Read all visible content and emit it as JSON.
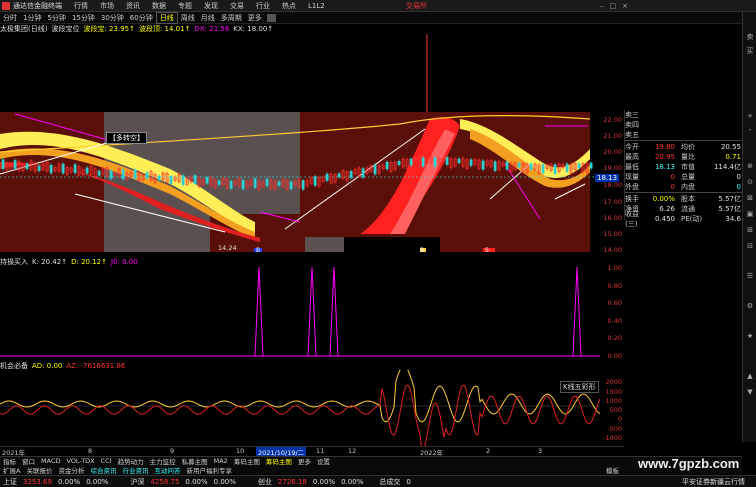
{
  "menubar": {
    "app_name": "通达信金融终端",
    "items": [
      "行情",
      "市场",
      "资讯",
      "数据",
      "专题",
      "发现",
      "交易",
      "行业",
      "热点",
      "L1L2"
    ],
    "trade_label": "交易所"
  },
  "toolbar": {
    "periods": [
      "分时",
      "1分钟",
      "5分钟",
      "15分钟",
      "30分钟",
      "60分钟",
      "日线",
      "周线",
      "月线",
      "多周期",
      "更多"
    ],
    "active_period": "日线"
  },
  "main_panel": {
    "title": "太极集团(日线)",
    "indicator_name": "波段宝位",
    "l1": "波段宝: 23.95↑",
    "l2": "波段顶: 14.01↑",
    "l3": "DX: 21.56",
    "l4": "KX: 18.00↑",
    "label_box": "【多转空】",
    "price_badge": "18.13",
    "markers": [
      "B",
      "B",
      "S"
    ],
    "low_label": "14.24",
    "yaxis": [
      "22.00",
      "21.00",
      "20.00",
      "19.00",
      "18.00",
      "17.00",
      "16.00",
      "15.00",
      "14.00"
    ]
  },
  "panel2": {
    "name": "持操买入",
    "k": "K: 20.42↑",
    "d": "D: 20.12↑",
    "j": "J0: 0.00",
    "yaxis": [
      "1.00",
      "0.80",
      "0.60",
      "0.40",
      "0.20",
      "0.00"
    ]
  },
  "panel3": {
    "name": "机会必备",
    "ad": "AD: 0.00",
    "az": "AZ: -7616631.86",
    "chip": "K线五彩形",
    "yaxis": [
      "2000",
      "1500",
      "1000",
      "500",
      "0",
      "-500",
      "-1000"
    ]
  },
  "quote": {
    "levels": [
      "卖三",
      "卖四",
      "卖五"
    ],
    "rows": [
      {
        "k": "今开",
        "v": "19.80",
        "k2": "均价",
        "v2": "20.55"
      },
      {
        "k": "最高",
        "v": "20.95",
        "k2": "量比",
        "v2": "0.71"
      },
      {
        "k": "最低",
        "v": "18.13",
        "k2": "市值",
        "v2": "114.4亿"
      },
      {
        "k": "现量",
        "v": "0",
        "k2": "总量",
        "v2": "0"
      },
      {
        "k": "外盘",
        "v": "0",
        "k2": "内盘",
        "v2": "0"
      },
      {
        "k": "换手",
        "v": "0.00%",
        "k2": "股本",
        "v2": "5.57亿"
      },
      {
        "k": "净资",
        "v": "6.26",
        "k2": "流通",
        "v2": "5.57亿"
      },
      {
        "k": "收益(三)",
        "v": "0.450",
        "k2": "PE(动)",
        "v2": "34.6"
      }
    ]
  },
  "datebar": {
    "dates": [
      "2021年",
      "8",
      "9",
      "10",
      "2021/10/19/二",
      "11",
      "12",
      "2022年",
      "2",
      "3"
    ]
  },
  "tabs1": [
    "指标",
    "窗口",
    "MACD",
    "VOL-TDX",
    "CCI",
    "趋势动力",
    "主力监控",
    "私募主图",
    "MA2",
    "筹码主图",
    "筹码主图",
    "更多",
    "设置"
  ],
  "tabs1_active": "筹码主图",
  "tabs2": [
    "扩展A",
    "关联报价",
    "资金分析",
    "综合资讯",
    "行业资讯",
    "互动问答",
    "新用户福利专享"
  ],
  "tabs2_right": "模板",
  "statusbar": {
    "sh_label": "上证",
    "sh_val": "3253.69",
    "sz_label": "沪深",
    "sz_val": "4258.75",
    "cy_label": "创业",
    "cy_val": "2726.18",
    "zero1": "0.00%",
    "zero2": "0.00%",
    "zero3": "0.00%",
    "zero4": "0.00%",
    "zero5": "0.00%",
    "zero6": "0.00%",
    "trade_label": "总成交",
    "trade_val": "0",
    "news": "平安证券新疆云行情"
  },
  "watermark": "www.7gpzb.com",
  "rightbar": [
    "卖",
    "买",
    "+",
    "-",
    "⊕",
    "⊙",
    "⊠",
    "▣",
    "⊞",
    "⊟",
    "☰",
    "⚙",
    "★",
    "▲",
    "▼"
  ]
}
